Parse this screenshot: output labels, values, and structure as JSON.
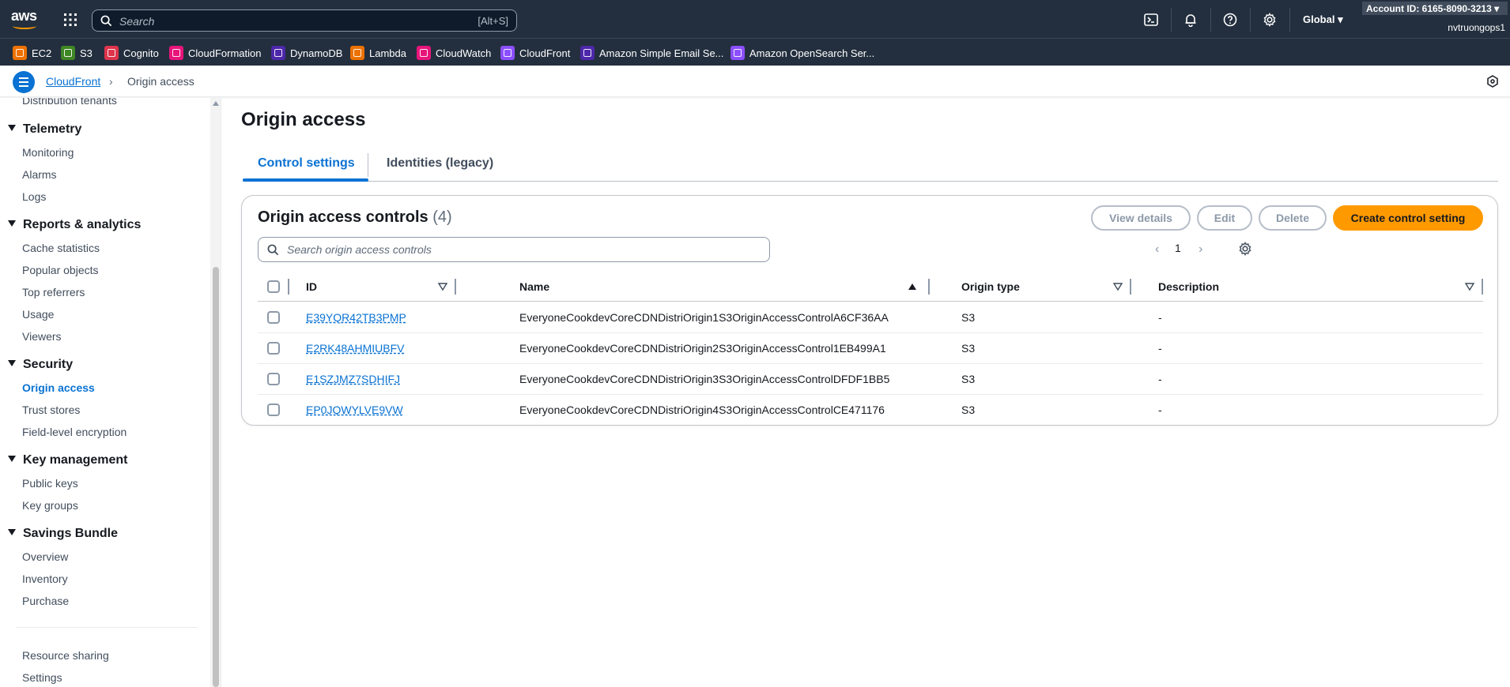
{
  "topbar": {
    "logo": "aws",
    "search_placeholder": "Search",
    "search_shortcut": "[Alt+S]",
    "region": "Global",
    "account": "Account ID: 6165-8090-3213",
    "user": "nvtruongops1",
    "icons": [
      "grid-icon",
      "cloudshell-icon",
      "bell-icon",
      "help-icon",
      "gear-icon"
    ]
  },
  "favorites": [
    {
      "label": "EC2",
      "color": "#ed7100"
    },
    {
      "label": "S3",
      "color": "#3f8624"
    },
    {
      "label": "Cognito",
      "color": "#dd344c"
    },
    {
      "label": "CloudFormation",
      "color": "#e7157b"
    },
    {
      "label": "DynamoDB",
      "color": "#4d27aa"
    },
    {
      "label": "Lambda",
      "color": "#ed7100"
    },
    {
      "label": "CloudWatch",
      "color": "#e7157b"
    },
    {
      "label": "CloudFront",
      "color": "#8c4fff"
    },
    {
      "label": "Amazon Simple Email Se...",
      "color": "#4d27aa"
    },
    {
      "label": "Amazon OpenSearch Ser...",
      "color": "#8c4fff"
    }
  ],
  "breadcrumb": {
    "parent": "CloudFront",
    "current": "Origin access"
  },
  "sidebar": {
    "top_item": "Distribution tenants",
    "sections": [
      {
        "title": "Telemetry",
        "items": [
          "Monitoring",
          "Alarms",
          "Logs"
        ]
      },
      {
        "title": "Reports & analytics",
        "items": [
          "Cache statistics",
          "Popular objects",
          "Top referrers",
          "Usage",
          "Viewers"
        ]
      },
      {
        "title": "Security",
        "items": [
          "Origin access",
          "Trust stores",
          "Field-level encryption"
        ]
      },
      {
        "title": "Key management",
        "items": [
          "Public keys",
          "Key groups"
        ]
      },
      {
        "title": "Savings Bundle",
        "items": [
          "Overview",
          "Inventory",
          "Purchase"
        ]
      }
    ],
    "active_item": "Origin access",
    "footer_items": [
      "Resource sharing",
      "Settings"
    ]
  },
  "main": {
    "title": "Origin access",
    "tabs": [
      "Control settings",
      "Identities (legacy)"
    ],
    "active_tab": "Control settings",
    "container": {
      "title": "Origin access controls",
      "count": "(4)",
      "buttons": {
        "view_details": "View details",
        "edit": "Edit",
        "delete": "Delete",
        "create": "Create control setting"
      },
      "filter_placeholder": "Search origin access controls",
      "page": "1",
      "columns": [
        "ID",
        "Name",
        "Origin type",
        "Description"
      ],
      "rows": [
        {
          "id": "E39YQR42TB3PMP",
          "name": "EveryoneCookdevCoreCDNDistriOrigin1S3OriginAccessControlA6CF36AA",
          "type": "S3",
          "description": "-"
        },
        {
          "id": "E2RK48AHMIUBFV",
          "name": "EveryoneCookdevCoreCDNDistriOrigin2S3OriginAccessControl1EB499A1",
          "type": "S3",
          "description": "-"
        },
        {
          "id": "E1SZJMZ7SDHIFJ",
          "name": "EveryoneCookdevCoreCDNDistriOrigin3S3OriginAccessControlDFDF1BB5",
          "type": "S3",
          "description": "-"
        },
        {
          "id": "EP0JQWYLVE9VW",
          "name": "EveryoneCookdevCoreCDNDistriOrigin4S3OriginAccessControlCE471176",
          "type": "S3",
          "description": "-"
        }
      ]
    }
  },
  "colors": {
    "nav_bg": "#232f3e",
    "link": "#0972d3",
    "primary_button": "#ff9900"
  }
}
